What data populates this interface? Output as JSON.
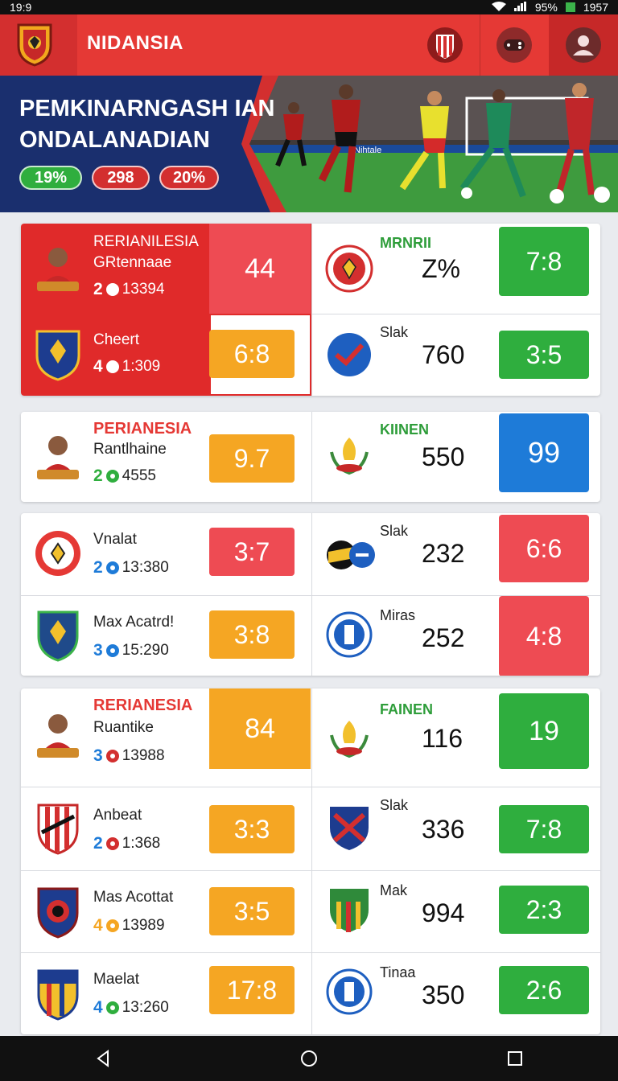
{
  "status": {
    "time": "19:9",
    "battery": "95%",
    "clock": "1957"
  },
  "app": {
    "brand": "NIDANSIA"
  },
  "hero": {
    "title_line1": "PEMKINARNGASH IAN",
    "title_line2": "ONDALANADIAN",
    "stats": [
      "19%",
      "298",
      "20%"
    ],
    "banner_text": "Nihtale"
  },
  "card1": {
    "left": [
      {
        "name": "RERIANILESIA",
        "sub": "GRtennaae",
        "num": "2",
        "meta": "13394",
        "score": "44"
      },
      {
        "name": "Cheert",
        "num": "4",
        "meta": "1:309",
        "score": "6:8"
      }
    ],
    "right": [
      {
        "label": "MRNRII",
        "value": "Z%",
        "score": "7:8"
      },
      {
        "label": "Slak",
        "value": "760",
        "score": "3:5"
      }
    ]
  },
  "card2": {
    "left": {
      "name": "PERIANESIA",
      "sub": "Rantlhaine",
      "num": "2",
      "meta": "4555",
      "score": "9.7"
    },
    "right": {
      "label": "KIINEN",
      "value": "550",
      "score": "99"
    }
  },
  "card3": {
    "rows": [
      {
        "name": "Vnalat",
        "num": "2",
        "meta": "13:380",
        "score": "3:7",
        "rlabel": "Slak",
        "rvalue": "232",
        "rscore": "6:6"
      },
      {
        "name": "Max Acatrd!",
        "num": "3",
        "meta": "15:290",
        "score": "3:8",
        "rlabel": "Miras",
        "rvalue": "252",
        "rscore": "4:8"
      }
    ]
  },
  "card4": {
    "top": {
      "name": "RERIANESIA",
      "sub": "Ruantike",
      "num": "3",
      "meta": "13988",
      "score": "84",
      "rlabel": "FAINEN",
      "rvalue": "116",
      "rscore": "19"
    },
    "rows": [
      {
        "name": "Anbeat",
        "num": "2",
        "meta": "1:368",
        "score": "3:3",
        "rlabel": "Slak",
        "rvalue": "336",
        "rscore": "7:8"
      },
      {
        "name": "Mas Acottat",
        "num": "4",
        "meta": "13989",
        "score": "3:5",
        "rlabel": "Mak",
        "rvalue": "994",
        "rscore": "2:3"
      },
      {
        "name": "Maelat",
        "num": "4",
        "meta": "13:260",
        "score": "17:8",
        "rlabel": "Tinaa",
        "rvalue": "350",
        "rscore": "2:6"
      }
    ]
  },
  "colors": {
    "red": "#e53935",
    "orange": "#f5a623",
    "green": "#2fae3e",
    "blue": "#1e7bd8",
    "navy": "#1a2f6e"
  }
}
